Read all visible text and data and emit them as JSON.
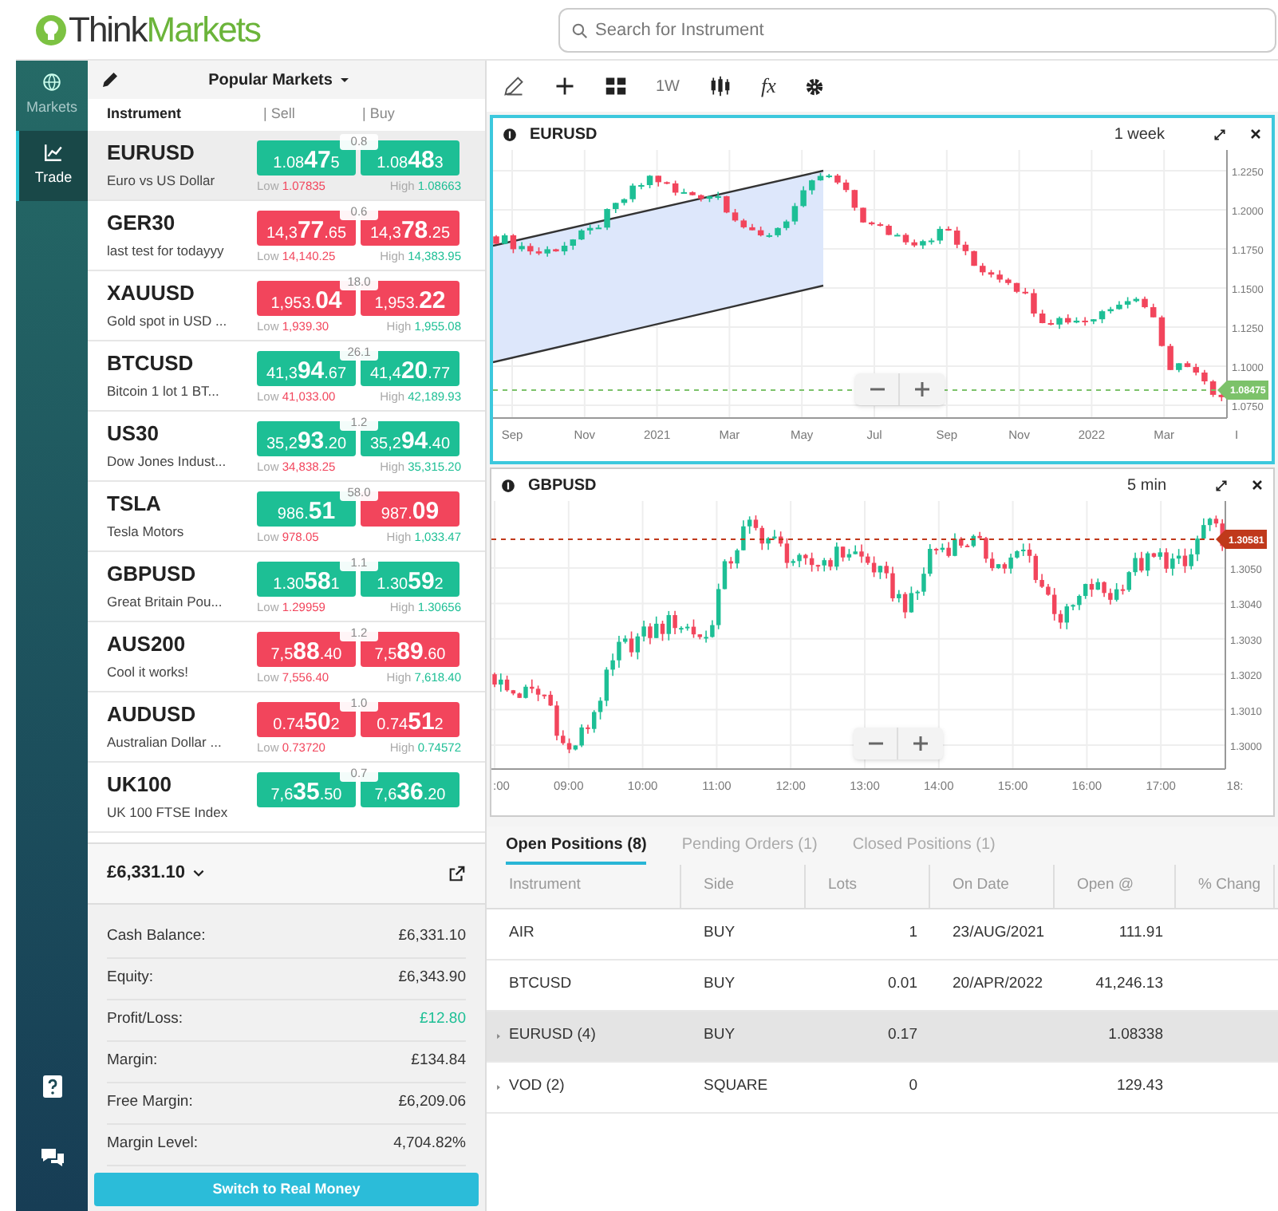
{
  "logo": {
    "part1": "Think",
    "part2": "Markets"
  },
  "search": {
    "placeholder": "Search for Instrument"
  },
  "nav": [
    {
      "label": "Markets",
      "selected": false
    },
    {
      "label": "Trade",
      "selected": true
    }
  ],
  "markets": {
    "title": "Popular Markets",
    "columns": [
      "Instrument",
      "| Sell",
      "| Buy"
    ],
    "rows": [
      {
        "symbol": "EURUSD",
        "description": "Euro vs US Dollar",
        "selected": true,
        "spread": "0.8",
        "sell": {
          "pre": "1.08",
          "big": "47",
          "post": "5",
          "rising": true
        },
        "buy": {
          "pre": "1.08",
          "big": "48",
          "post": "3",
          "rising": true
        },
        "low_label": "Low",
        "low": "1.07835",
        "high_label": "High",
        "high": "1.08663"
      },
      {
        "symbol": "GER30",
        "description": "last test for todayyy",
        "selected": false,
        "spread": "0.6",
        "sell": {
          "pre": "14,3",
          "big": "77",
          "post": ".65",
          "rising": false
        },
        "buy": {
          "pre": "14,3",
          "big": "78",
          "post": ".25",
          "rising": false
        },
        "low_label": "Low",
        "low": "14,140.25",
        "high_label": "High",
        "high": "14,383.95"
      },
      {
        "symbol": "XAUUSD",
        "description": "Gold spot in USD ...",
        "selected": false,
        "spread": "18.0",
        "sell": {
          "pre": "1,953.",
          "big": "04",
          "rising": false
        },
        "buy": {
          "pre": "1,953.",
          "big": "22",
          "rising": false
        },
        "low_label": "Low",
        "low": "1,939.30",
        "high_label": "High",
        "high": "1,955.08"
      },
      {
        "symbol": "BTCUSD",
        "description": "Bitcoin 1 lot 1 BT...",
        "selected": false,
        "spread": "26.1",
        "sell": {
          "pre": "41,3",
          "big": "94",
          "post": ".67",
          "rising": true
        },
        "buy": {
          "pre": "41,4",
          "big": "20",
          "post": ".77",
          "rising": true
        },
        "low_label": "Low",
        "low": "41,033.00",
        "high_label": "High",
        "high": "42,189.93"
      },
      {
        "symbol": "US30",
        "description": "Dow Jones Indust...",
        "selected": false,
        "spread": "1.2",
        "sell": {
          "pre": "35,2",
          "big": "93",
          "post": ".20",
          "rising": true
        },
        "buy": {
          "pre": "35,2",
          "big": "94",
          "post": ".40",
          "rising": true
        },
        "low_label": "Low",
        "low": "34,838.25",
        "high_label": "High",
        "high": "35,315.20"
      },
      {
        "symbol": "TSLA",
        "description": "Tesla Motors",
        "selected": false,
        "spread": "58.0",
        "sell": {
          "pre": "986.",
          "big": "51",
          "rising": true
        },
        "buy": {
          "pre": "987.",
          "big": "09",
          "rising": false
        },
        "low_label": "Low",
        "low": "978.05",
        "high_label": "High",
        "high": "1,033.47"
      },
      {
        "symbol": "GBPUSD",
        "description": "Great Britain Pou...",
        "selected": false,
        "spread": "1.1",
        "sell": {
          "pre": "1.30",
          "big": "58",
          "post": "1",
          "rising": true
        },
        "buy": {
          "pre": "1.30",
          "big": "59",
          "post": "2",
          "rising": true
        },
        "low_label": "Low",
        "low": "1.29959",
        "high_label": "High",
        "high": "1.30656"
      },
      {
        "symbol": "AUS200",
        "description": "Cool it works!",
        "selected": false,
        "spread": "1.2",
        "sell": {
          "pre": "7,5",
          "big": "88",
          "post": ".40",
          "rising": false
        },
        "buy": {
          "pre": "7,5",
          "big": "89",
          "post": ".60",
          "rising": false
        },
        "low_label": "Low",
        "low": "7,556.40",
        "high_label": "High",
        "high": "7,618.40"
      },
      {
        "symbol": "AUDUSD",
        "description": "Australian Dollar ...",
        "selected": false,
        "spread": "1.0",
        "sell": {
          "pre": "0.74",
          "big": "50",
          "post": "2",
          "rising": false
        },
        "buy": {
          "pre": "0.74",
          "big": "51",
          "post": "2",
          "rising": false
        },
        "low_label": "Low",
        "low": "0.73720",
        "high_label": "High",
        "high": "0.74572"
      },
      {
        "symbol": "UK100",
        "description": "UK 100 FTSE Index",
        "selected": false,
        "spread": "0.7",
        "sell": {
          "pre": "7,6",
          "big": "35",
          "post": ".50",
          "rising": true
        },
        "buy": {
          "pre": "7,6",
          "big": "36",
          "post": ".20",
          "rising": true
        }
      }
    ]
  },
  "account": {
    "balance": "£6,331.10",
    "items": [
      {
        "label": "Cash Balance:",
        "value": "£6,331.10",
        "color": "#333333"
      },
      {
        "label": "Equity:",
        "value": "£6,343.90",
        "color": "#333333"
      },
      {
        "label": "Profit/Loss:",
        "value": "£12.80",
        "color": "#1dbf95"
      },
      {
        "label": "Margin:",
        "value": "£134.84",
        "color": "#333333"
      },
      {
        "label": "Free Margin:",
        "value": "£6,209.06",
        "color": "#333333"
      },
      {
        "label": "Margin Level:",
        "value": "4,704.82%",
        "color": "#333333"
      }
    ],
    "button": "Switch to Real Money"
  },
  "toolbar": {
    "timeframe": "1W",
    "formula": "fx"
  },
  "charts": [
    {
      "symbol": "EURUSD",
      "timeframe": "1 week",
      "selected": true,
      "price_tag": "1.08475",
      "rising": true,
      "y_labels": [
        "1.2250",
        "1.2000",
        "1.1750",
        "1.1500",
        "1.1250",
        "1.1000",
        "1.0750"
      ],
      "x_labels": [
        "Sep",
        "Nov",
        "2021",
        "Mar",
        "May",
        "Jul",
        "Sep",
        "Nov",
        "2022",
        "Mar",
        "I"
      ]
    },
    {
      "symbol": "GBPUSD",
      "timeframe": "5 min",
      "selected": false,
      "price_tag": "1.30581",
      "rising": false,
      "y_labels": [
        "1.3050",
        "1.3040",
        "1.3030",
        "1.3020",
        "1.3010",
        "1.3000"
      ],
      "x_labels": [
        ":00",
        "09:00",
        "10:00",
        "11:00",
        "12:00",
        "13:00",
        "14:00",
        "15:00",
        "16:00",
        "17:00",
        "18:"
      ]
    }
  ],
  "positions": {
    "tabs": [
      {
        "label": "Open Positions (8)",
        "selected": true
      },
      {
        "label": "Pending Orders (1)",
        "selected": false
      },
      {
        "label": "Closed Positions (1)",
        "selected": false
      }
    ],
    "columns": [
      "Instrument",
      "Side",
      "Lots",
      "On Date",
      "Open @",
      "% Chang"
    ],
    "rows": [
      {
        "kind": "single",
        "selected": false,
        "cells": [
          "AIR",
          "BUY",
          "1",
          "23/AUG/2021",
          "111.91"
        ]
      },
      {
        "kind": "single",
        "selected": false,
        "cells": [
          "BTCUSD",
          "BUY",
          "0.01",
          "20/APR/2022",
          "41,246.13"
        ]
      },
      {
        "kind": "group",
        "selected": true,
        "cells": [
          "EURUSD (4)",
          "BUY",
          "0.17",
          "",
          "1.08338"
        ]
      },
      {
        "kind": "group",
        "selected": false,
        "cells": [
          "VOD (2)",
          "SQUARE",
          "0",
          "",
          "129.43"
        ]
      }
    ]
  }
}
